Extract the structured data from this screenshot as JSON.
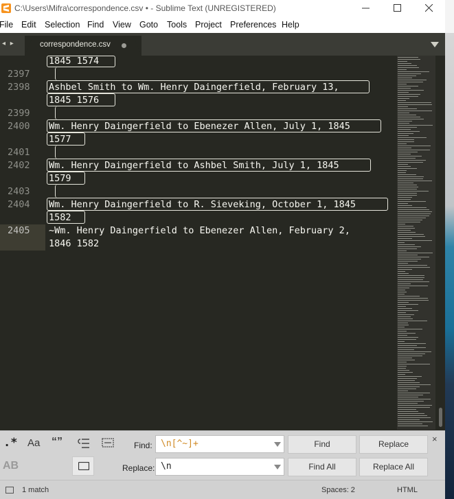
{
  "window": {
    "title": "C:\\Users\\Mifra\\correspondence.csv • - Sublime Text (UNREGISTERED)",
    "app_icon": "sublime-text-icon",
    "controls": [
      "minimize-icon",
      "maximize-icon",
      "close-icon"
    ]
  },
  "menu": {
    "items": [
      "File",
      "Edit",
      "Selection",
      "Find",
      "View",
      "Goto",
      "Tools",
      "Project",
      "Preferences",
      "Help"
    ]
  },
  "tabs": {
    "nav_icon": "◂ ▸",
    "active": {
      "label": "correspondence.csv",
      "dirty": true
    },
    "dropdown_icon": "chevron-down-icon"
  },
  "editor": {
    "lines": [
      {
        "text": "1845 1574"
      },
      {
        "number": "2397",
        "text": ""
      },
      {
        "number": "2398",
        "text": "Ashbel Smith to Wm. Henry Daingerfield, February 13,"
      },
      {
        "text": "1845 1576"
      },
      {
        "number": "2399",
        "text": ""
      },
      {
        "number": "2400",
        "text": "Wm. Henry Daingerfield to Ebenezer Allen, July 1, 1845"
      },
      {
        "text": "1577"
      },
      {
        "number": "2401",
        "text": ""
      },
      {
        "number": "2402",
        "text": "Wm. Henry Daingerfield to Ashbel Smith, July 1, 1845"
      },
      {
        "text": "1579"
      },
      {
        "number": "2403",
        "text": ""
      },
      {
        "number": "2404",
        "text": "Wm. Henry Daingerfield to R. Sieveking, October 1, 1845"
      },
      {
        "text": "1582"
      },
      {
        "number": "2405",
        "text": "~Wm. Henry Daingerfield to Ebenezer Allen, February 2,"
      },
      {
        "text": "1846 1582"
      }
    ],
    "active_line": "2405",
    "colors": {
      "background": "#272822",
      "text": "#f8f8f2",
      "gutter_text": "#8f908a",
      "highlight_border": "#e6e6dc"
    }
  },
  "find_panel": {
    "options": {
      "regex": ".*",
      "case": "Aa",
      "whole_word": "“”",
      "wrap_icon": "wrap-icon",
      "in_selection_icon": "in-selection-icon",
      "preserve_case": "AB",
      "highlight_icon": "highlight-matches-icon"
    },
    "find_label": "Find:",
    "find_value": "\\n[^~]+",
    "replace_label": "Replace:",
    "replace_value": "\\n",
    "buttons": {
      "find": "Find",
      "replace": "Replace",
      "find_all": "Find All",
      "replace_all": "Replace All"
    },
    "close": "×"
  },
  "status_bar": {
    "matches": "1 match",
    "spaces": "Spaces: 2",
    "syntax": "HTML"
  }
}
